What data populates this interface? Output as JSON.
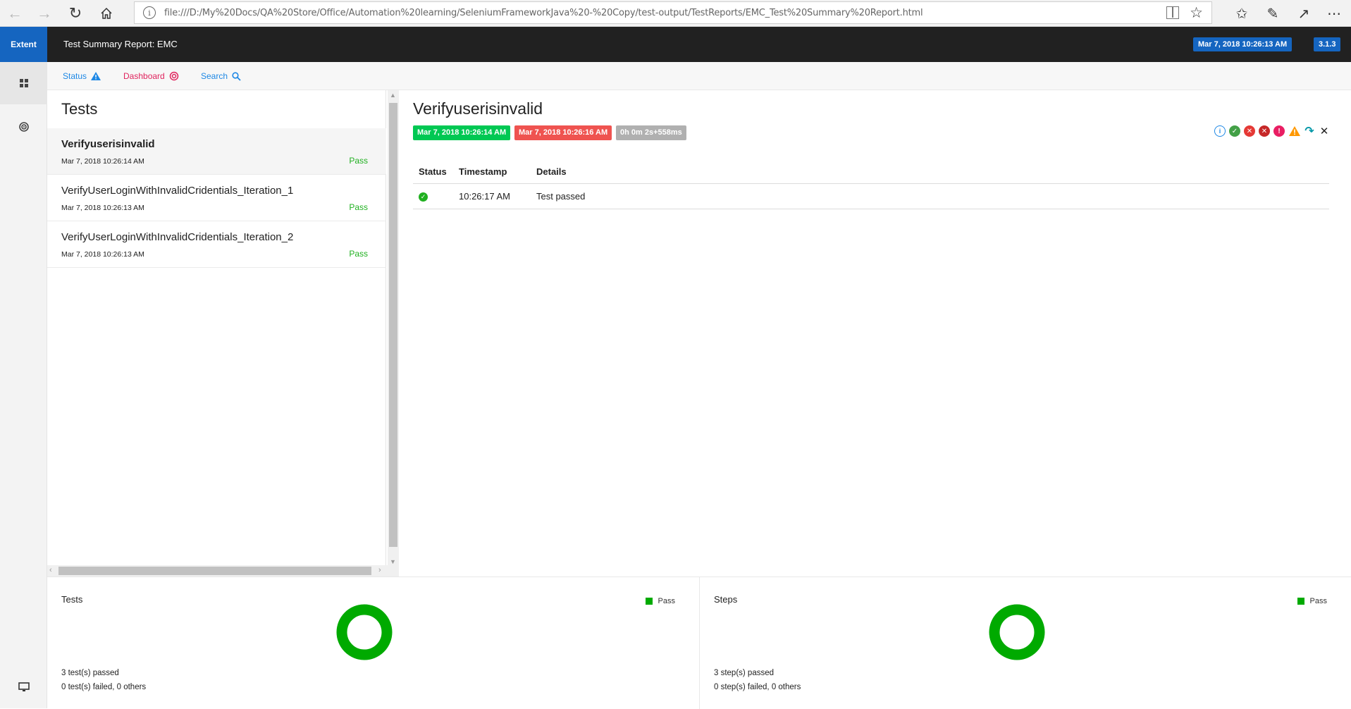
{
  "browser": {
    "url": "file:///D:/My%20Docs/QA%20Store/Office/Automation%20learning/SeleniumFrameworkJava%20-%20Copy/test-output/TestReports/EMC_Test%20Summary%20Report.html",
    "icons": [
      "back-icon",
      "forward-icon",
      "refresh-icon",
      "home-icon",
      "info-icon",
      "reading-view-icon",
      "favorite-star-icon",
      "favorites-list-icon",
      "pen-icon",
      "share-icon",
      "more-icon"
    ]
  },
  "header": {
    "brand": "Extent",
    "report_name": "Test Summary Report: EMC",
    "timestamp": "Mar 7, 2018 10:26:13 AM",
    "version": "3.1.3",
    "accent": "#1565c0"
  },
  "subnav": {
    "status_label": "Status",
    "dashboard_label": "Dashboard",
    "search_label": "Search"
  },
  "test_list": {
    "title": "Tests",
    "items": [
      {
        "name": "Verifyuserisinvalid",
        "time": "Mar 7, 2018 10:26:14 AM",
        "status": "Pass"
      },
      {
        "name": "VerifyUserLoginWithInvalidCridentials_Iteration_1",
        "time": "Mar 7, 2018 10:26:13 AM",
        "status": "Pass"
      },
      {
        "name": "VerifyUserLoginWithInvalidCridentials_Iteration_2",
        "time": "Mar 7, 2018 10:26:13 AM",
        "status": "Pass"
      }
    ]
  },
  "detail": {
    "title": "Verifyuserisinvalid",
    "start_time": "Mar 7, 2018 10:26:14 AM",
    "end_time": "Mar 7, 2018 10:26:16 AM",
    "duration": "0h 0m 2s+558ms",
    "filter_icons": [
      "info-icon",
      "pass-icon",
      "fail-icon",
      "fatal-icon",
      "error-icon",
      "warning-icon",
      "skip-icon",
      "clear-filter-icon"
    ],
    "columns": [
      "Status",
      "Timestamp",
      "Details"
    ],
    "rows": [
      {
        "status_icon": "pass-check-icon",
        "timestamp": "10:26:17 AM",
        "details": "Test passed"
      }
    ]
  },
  "charts": {
    "tests": {
      "title": "Tests",
      "legend": "Pass",
      "summary1": "3 test(s) passed",
      "summary2": "0 test(s) failed, 0 others"
    },
    "steps": {
      "title": "Steps",
      "legend": "Pass",
      "summary1": "3 step(s) passed",
      "summary2": "0 step(s) failed, 0 others"
    },
    "pass_color": "#00aa00"
  }
}
